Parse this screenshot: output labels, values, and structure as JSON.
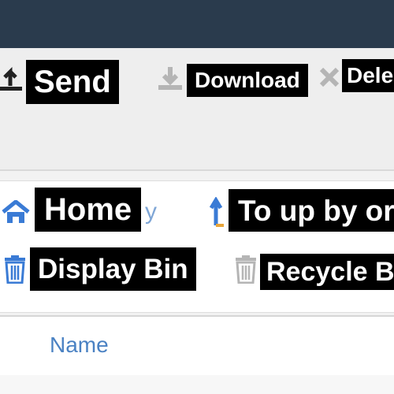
{
  "toolbar": {
    "send_label": "Send",
    "download_label": "Download",
    "delete_label": "Dele"
  },
  "nav": {
    "home_label": "Home",
    "home_overlap_text": "y",
    "up_label": "To up by or",
    "display_bin_label": "Display Bin",
    "recycle_bin_label": "Recycle B"
  },
  "list": {
    "name_header": "Name"
  },
  "colors": {
    "topbar": "#2a3b4d",
    "accent_blue": "#4b82c3",
    "icon_blue": "#3a7bd5",
    "icon_gray": "#b5b5b5",
    "up_orange": "#e8a53a"
  }
}
